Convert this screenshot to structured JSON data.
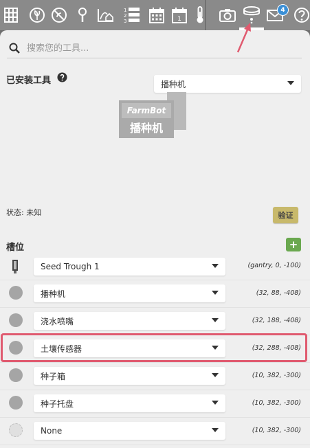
{
  "nav": {
    "icons": [
      "grid-icon",
      "plant-icon",
      "weed-icon",
      "location-pin-icon",
      "house-curve-icon",
      "sequences-icon",
      "calendar-icon",
      "calendar-day-icon",
      "thermometer-icon",
      "camera-icon",
      "seeder-icon",
      "mail-icon",
      "help-icon"
    ],
    "messages_count": "4",
    "calendar_day": "1"
  },
  "search": {
    "placeholder": "搜索您的工具..."
  },
  "installed": {
    "label": "已安装工具",
    "selected": "播种机",
    "image_brand": "FarmBot",
    "image_text": "播种机"
  },
  "status": {
    "text": "状态: 未知"
  },
  "verify_label": "验证",
  "slots": {
    "title": "槽位",
    "add_label": "+",
    "items": [
      {
        "tool": "Seed Trough 1",
        "coords": "(gantry, 0, -100)"
      },
      {
        "tool": "播种机",
        "coords": "(32, 88, -408)"
      },
      {
        "tool": "浇水喷嘴",
        "coords": "(32, 188, -408)"
      },
      {
        "tool": "土壤传感器",
        "coords": "(32, 288, -408)"
      },
      {
        "tool": "种子箱",
        "coords": "(10, 382, -300)"
      },
      {
        "tool": "种子托盘",
        "coords": "(10, 382, -300)"
      },
      {
        "tool": "None",
        "coords": "(10, 382, -300)"
      }
    ]
  },
  "colors": {
    "nav_bg": "#8a8a8a",
    "panel_bg": "#efefef",
    "highlight": "#e05a6f",
    "add_button": "#6aa84f",
    "verify_button": "#c8b96b",
    "badge": "#3a8fd6"
  }
}
